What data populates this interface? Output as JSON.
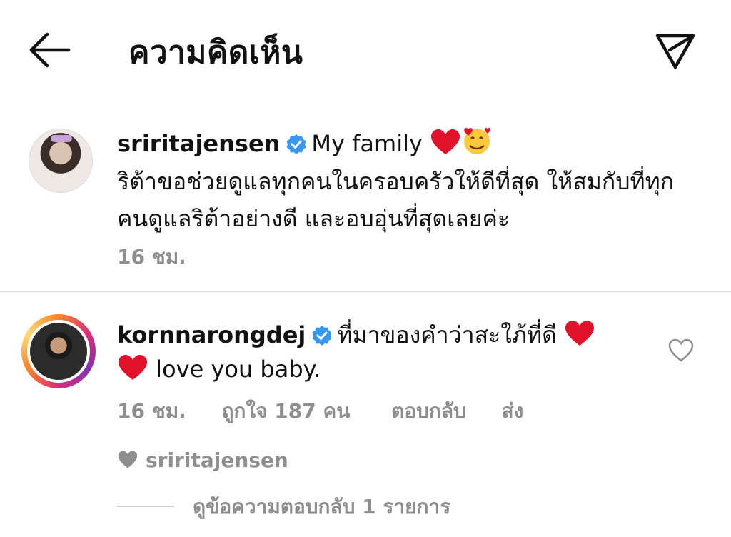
{
  "header": {
    "title": "ความคิดเห็น",
    "back_icon": "arrow-left-icon",
    "send_icon": "paper-plane-icon"
  },
  "caption": {
    "username": "sriritajensen",
    "verified": true,
    "text_inline": "My family",
    "emojis": [
      "red-heart",
      "smiling-face-with-hearts"
    ],
    "text": "ริต้าขอช่วยดูแลทุกคนในครอบครัวให้ดีที่สุด ให้สมกับที่ทุกคนดูแลริต้าอย่างดี และอบอุ่นที่สุดเลยค่ะ",
    "time": "16 ชม."
  },
  "comment": {
    "username": "kornnarongdej",
    "verified": true,
    "text_line1": "ที่มาของคำว่าสะใภ้ที่ดี",
    "text_line2": "love you baby.",
    "time": "16 ชม.",
    "likes_label": "ถูกใจ 187 คน",
    "reply_label": "ตอบกลับ",
    "send_label": "ส่ง",
    "liked_by": "sriritajensen",
    "view_replies": "ดูข้อความตอบกลับ 1 รายการ"
  },
  "colors": {
    "verified_blue": "#3897f0",
    "heart_red": "#e0122b",
    "muted_text": "#8e8e8e"
  }
}
